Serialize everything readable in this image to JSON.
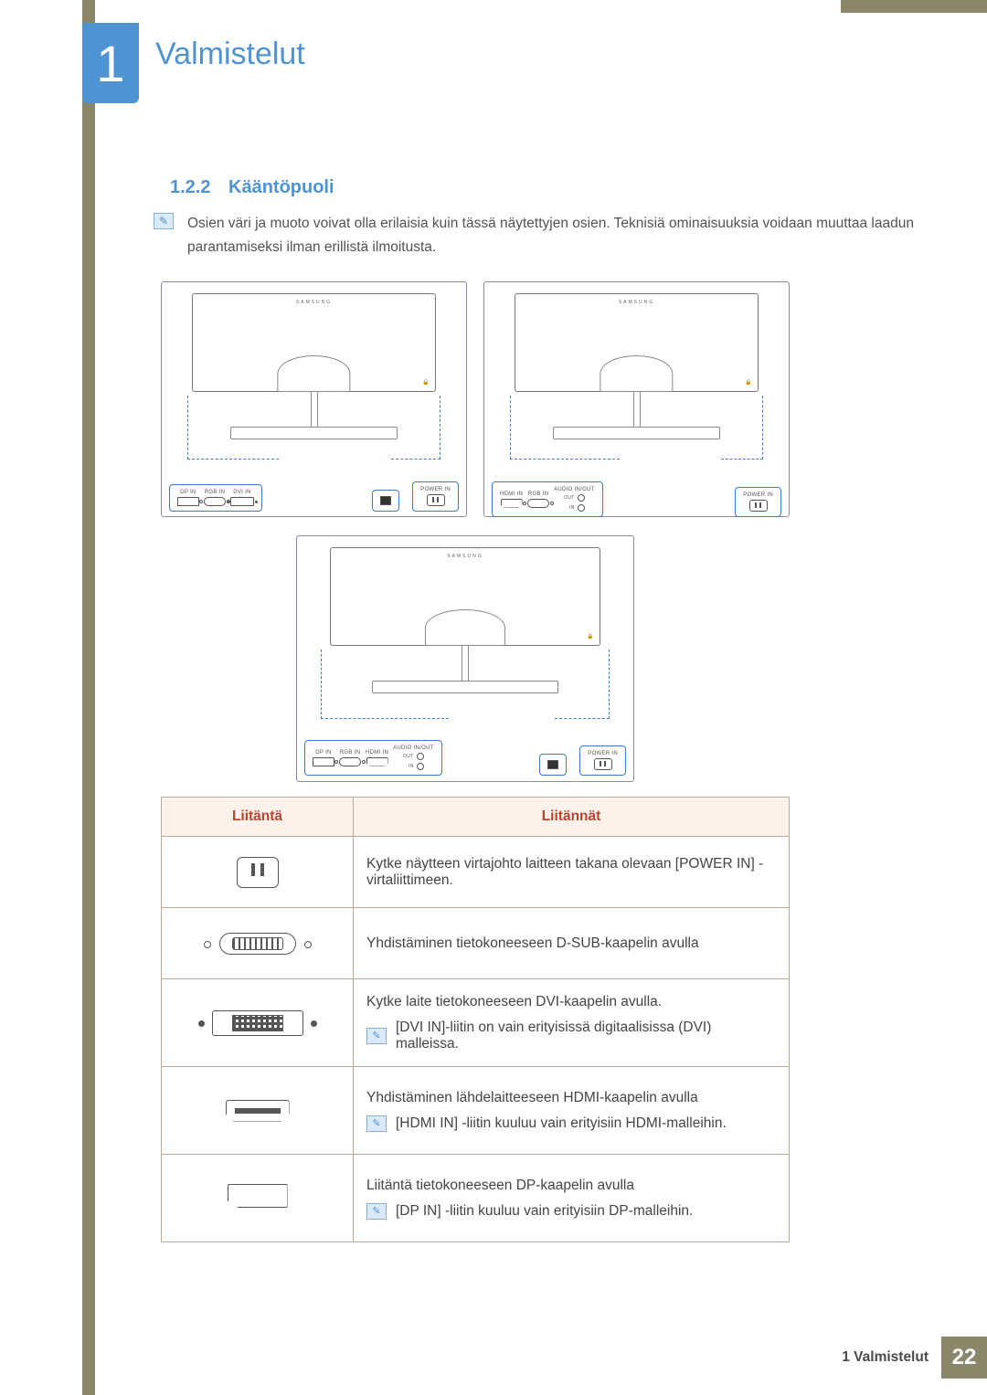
{
  "chapter": {
    "number": "1",
    "title": "Valmistelut"
  },
  "section": {
    "number": "1.2.2",
    "title": "Kääntöpuoli"
  },
  "intro_note": "Osien väri ja muoto voivat olla erilaisia kuin tässä näytettyjen osien. Teknisiä ominaisuuksia voidaan muuttaa laadun parantamiseksi ilman erillistä ilmoitusta.",
  "diagrams": {
    "variant_a": {
      "ports_left": [
        "DP IN",
        "RGB IN",
        "DVI IN"
      ],
      "ports_right": [
        "POWER IN"
      ]
    },
    "variant_b": {
      "ports_left": [
        "HDMI IN",
        "RGB IN"
      ],
      "audio": {
        "label": "AUDIO IN/OUT",
        "out": "OUT",
        "in": "IN"
      },
      "ports_right": [
        "POWER IN"
      ]
    },
    "variant_c": {
      "ports_left": [
        "DP IN",
        "RGB IN",
        "HDMI IN"
      ],
      "audio": {
        "label": "AUDIO IN/OUT",
        "out": "OUT",
        "in": "IN"
      },
      "ports_right": [
        "POWER IN"
      ]
    }
  },
  "table": {
    "headers": [
      "Liitäntä",
      "Liitännät"
    ],
    "rows": [
      {
        "icon": "power",
        "text": "Kytke näytteen virtajohto laitteen takana olevaan [POWER IN] -virtaliittimeen."
      },
      {
        "icon": "vga",
        "text": "Yhdistäminen tietokoneeseen D-SUB-kaapelin avulla"
      },
      {
        "icon": "dvi",
        "text": "Kytke laite tietokoneeseen DVI-kaapelin avulla.",
        "note": "[DVI IN]-liitin on vain erityisissä digitaalisissa (DVI) malleissa."
      },
      {
        "icon": "hdmi",
        "text": "Yhdistäminen lähdelaitteeseen HDMI-kaapelin avulla",
        "note": "[HDMI IN] -liitin kuuluu vain erityisiin HDMI-malleihin."
      },
      {
        "icon": "dp",
        "text": "Liitäntä tietokoneeseen DP-kaapelin avulla",
        "note": "[DP IN] -liitin kuuluu vain erityisiin DP-malleihin."
      }
    ]
  },
  "footer": {
    "chapter_label": "1 Valmistelut",
    "page": "22"
  }
}
